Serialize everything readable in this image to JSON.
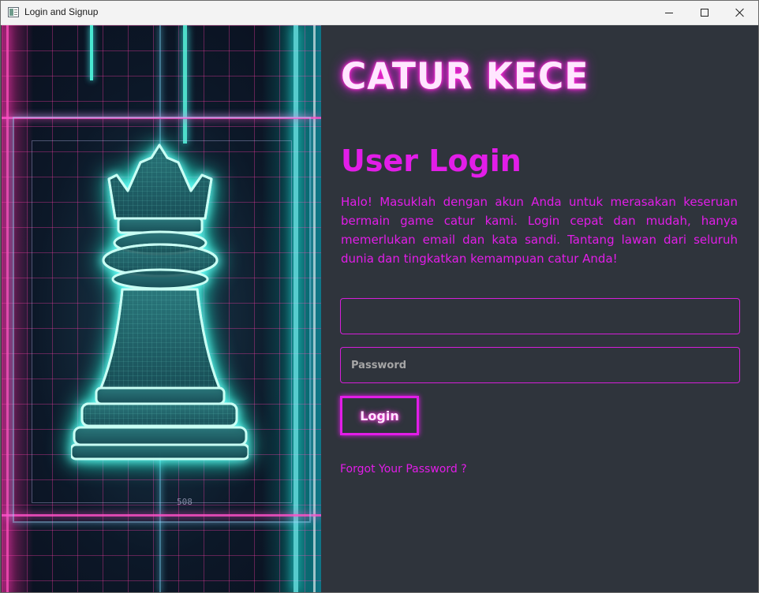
{
  "window": {
    "title": "Login and Signup",
    "controls": [
      "minimize-icon",
      "maximize-icon",
      "close-icon"
    ]
  },
  "art": {
    "frame_label": "508"
  },
  "login": {
    "logo": "CATUR KECE",
    "heading": "User Login",
    "intro": "Halo! Masuklah dengan akun Anda untuk merasakan keseruan bermain game catur kami. Login cepat dan mudah, hanya memerlukan email dan kata sandi. Tantang lawan dari seluruh dunia dan tingkatkan kemampuan catur Anda!",
    "email": {
      "value": "",
      "placeholder": ""
    },
    "password": {
      "value": "",
      "placeholder": "Password"
    },
    "login_button": "Login",
    "forgot_link": "Forgot Your Password ?"
  },
  "colors": {
    "background": "#2f343c",
    "accent_magenta": "#e21de8",
    "titlebar": "#f3f3f3",
    "neon_cyan": "#4ffff0"
  }
}
